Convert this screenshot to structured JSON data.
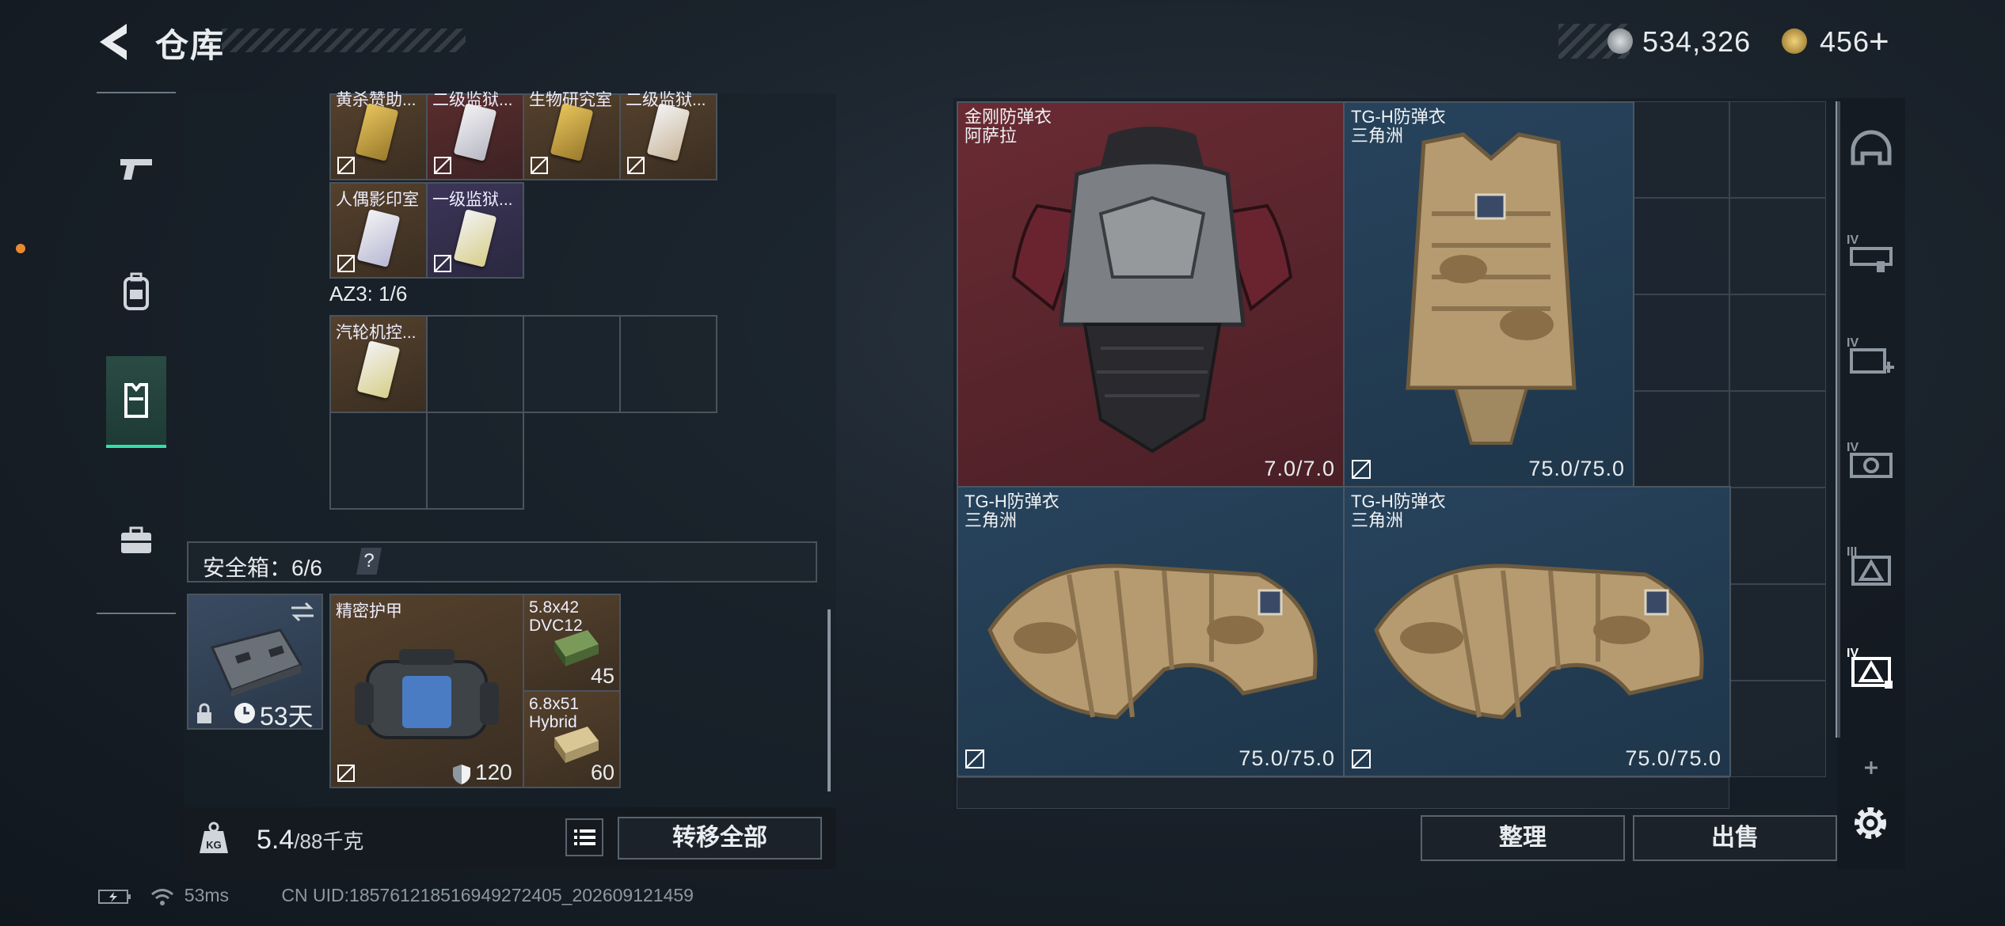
{
  "header": {
    "title": "仓库",
    "currency_silver": "534,326",
    "currency_gold": "456",
    "plus_label": "+"
  },
  "backpack": {
    "row1": [
      {
        "label": "黄杀赞助...",
        "color": "brown"
      },
      {
        "label": "二级监狱...",
        "color": "red"
      },
      {
        "label": "生物研究室",
        "color": "brown"
      },
      {
        "label": "二级监狱...",
        "color": "brown"
      }
    ],
    "row2": [
      {
        "label": "人偶影印室",
        "color": "brown"
      },
      {
        "label": "一级监狱...",
        "color": "purple"
      }
    ],
    "az3_label": "AZ3: 1/6",
    "az3_item": "汽轮机控..."
  },
  "safebox": {
    "label": "安全箱：6/6",
    "help": "?",
    "days": "53天",
    "armor_name": "精密护甲",
    "armor_value": "120",
    "ammo1_name": "5.8x42 DVC12",
    "ammo1_count": "45",
    "ammo2_name": "6.8x51 Hybrid",
    "ammo2_count": "60"
  },
  "weight": {
    "current": "5.4",
    "max": "/88千克",
    "icon_text": "KG",
    "transfer_all": "转移全部"
  },
  "status": {
    "ping": "53ms",
    "uid": "CN UID:18576121851694927240​5_202609121459"
  },
  "items": [
    {
      "name": "金刚防弹衣",
      "sub": "阿萨拉",
      "durability": "7.0/7.0"
    },
    {
      "name": "TG-H防弹衣",
      "sub": "三角洲",
      "durability": "75.0/75.0"
    },
    {
      "name": "TG-H防弹衣",
      "sub": "三角洲",
      "durability": "75.0/75.0"
    },
    {
      "name": "TG-H防弹衣",
      "sub": "三角洲",
      "durability": "75.0/75.0"
    }
  ],
  "actions": {
    "sort": "整理",
    "sell": "出售"
  },
  "filters": {
    "iv": "IV",
    "iii": "III"
  },
  "colors": {
    "accent": "#33e0a8",
    "orange_dot": "#e88a30",
    "rarity_red": "#6a2b33",
    "rarity_blue": "#27435c"
  }
}
